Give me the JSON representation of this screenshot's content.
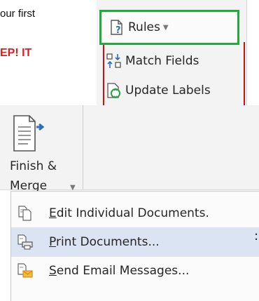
{
  "document": {
    "text_line_1": "our first",
    "text_line_2": "EP! IT"
  },
  "ribbon_group": {
    "rules": {
      "label": "Rules"
    },
    "match_fields": {
      "label": "Match Fields"
    },
    "update_labels": {
      "label": "Update Labels"
    }
  },
  "finish_merge": {
    "label_line_1": "Finish &",
    "label_line_2": "Merge"
  },
  "menu": {
    "items": [
      {
        "mnemonic": "E",
        "rest": "dit Individual Documents.",
        "icon": "edit-documents-icon"
      },
      {
        "mnemonic": "P",
        "rest": "rint Documents...",
        "icon": "print-documents-icon"
      },
      {
        "mnemonic": "S",
        "rest": "end Email Messages...",
        "icon": "send-email-icon"
      }
    ],
    "print_side_glyph": ":"
  },
  "colors": {
    "highlight_border": "#1fac3a",
    "red_outline": "#d20f0f",
    "alert_text": "#e21a1a",
    "menu_selected": "#dbe4f2"
  }
}
